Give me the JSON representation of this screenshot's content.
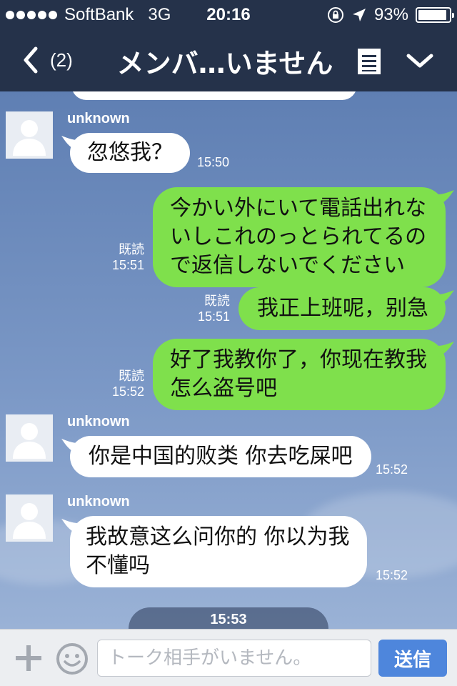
{
  "status_bar": {
    "carrier": "SoftBank",
    "network": "3G",
    "time": "20:16",
    "battery": "93%",
    "battery_level": 0.93,
    "icons": [
      "signal-dots-icon",
      "rotation-lock-icon",
      "location-arrow-icon",
      "battery-icon"
    ]
  },
  "nav": {
    "back_icon": "chevron-left-icon",
    "unread_count": "(2)",
    "title": "メンバ…いません",
    "menu_icon": "document-menu-icon",
    "dropdown_icon": "chevron-down-icon"
  },
  "messages": [
    {
      "side": "in",
      "sender": "unknown",
      "text_lines": [
        "忽悠我？"
      ],
      "time": "15:50"
    },
    {
      "side": "out",
      "read": "既読",
      "text_lines": [
        "今かい外にいて電話出れな",
        "いしこれのっとられてるの",
        "で返信しないでください"
      ],
      "time": "15:51"
    },
    {
      "side": "out",
      "read": "既読",
      "text_lines": [
        "我正上班呢，别急"
      ],
      "time": "15:51"
    },
    {
      "side": "out",
      "read": "既読",
      "text_lines": [
        "好了我教你了，你现在教我",
        "怎么盗号吧"
      ],
      "time": "15:52"
    },
    {
      "side": "in",
      "sender": "unknown",
      "text_lines": [
        "你是中国的败类 你去吃屎吧"
      ],
      "time": "15:52"
    },
    {
      "side": "in",
      "sender": "unknown",
      "text_lines": [
        "我故意这么问你的 你以为我",
        "不懂吗"
      ],
      "time": "15:52"
    }
  ],
  "time_divider": "15:53",
  "input_bar": {
    "plus_icon": "plus-icon",
    "emoji_icon": "smiley-icon",
    "placeholder": "トーク相手がいません。",
    "send_label": "送信"
  },
  "colors": {
    "header": "#25324a",
    "outgoing_bubble": "#7fe04c",
    "incoming_bubble": "#ffffff",
    "send_button": "#4e86dc",
    "chat_background": "#6e8fbf"
  }
}
